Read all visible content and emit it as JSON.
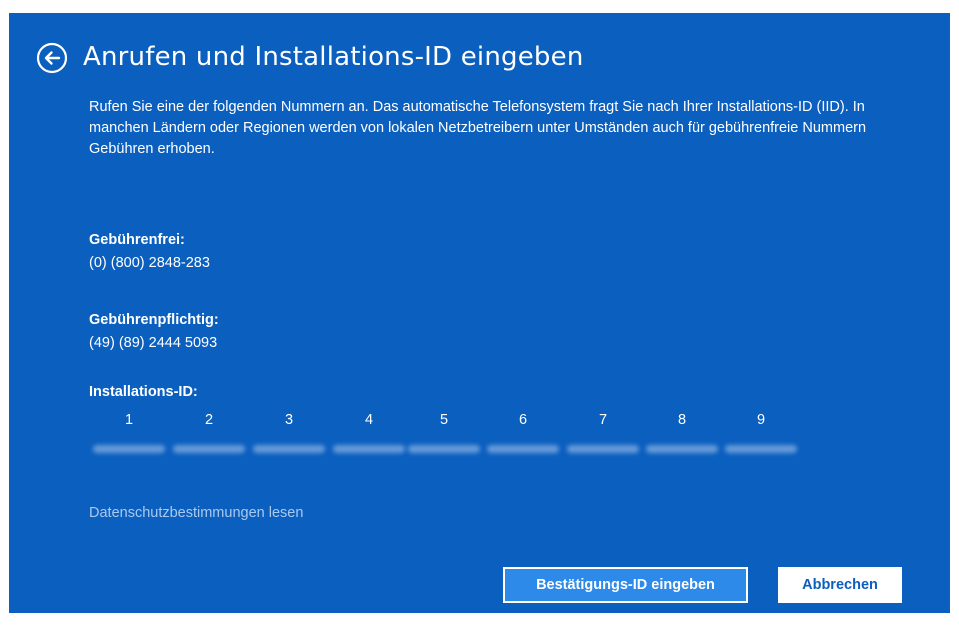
{
  "title": "Anrufen und Installations-ID eingeben",
  "intro": "Rufen Sie eine der folgenden Nummern an. Das automatische Telefonsystem fragt Sie nach Ihrer Installations-ID (IID). In manchen Ländern oder Regionen werden von lokalen Netzbetreibern unter Umständen auch für gebührenfreie Nummern Gebühren erhoben.",
  "toll_free": {
    "label": "Gebührenfrei:",
    "number": "(0) (800) 2848-283"
  },
  "toll": {
    "label": "Gebührenpflichtig:",
    "number": "(49) (89) 2444 5093"
  },
  "installation_id": {
    "label": "Installations-ID:",
    "group_numbers": [
      "1",
      "2",
      "3",
      "4",
      "5",
      "6",
      "7",
      "8",
      "9"
    ]
  },
  "privacy_link": "Datenschutzbestimmungen lesen",
  "buttons": {
    "confirm": "Bestätigungs-ID eingeben",
    "cancel": "Abbrechen"
  },
  "colors": {
    "background": "#0b5fbf",
    "primary_button": "#2e8ae8",
    "link": "#a9c9ef"
  },
  "icons": {
    "back": "back-arrow-circle-icon"
  }
}
